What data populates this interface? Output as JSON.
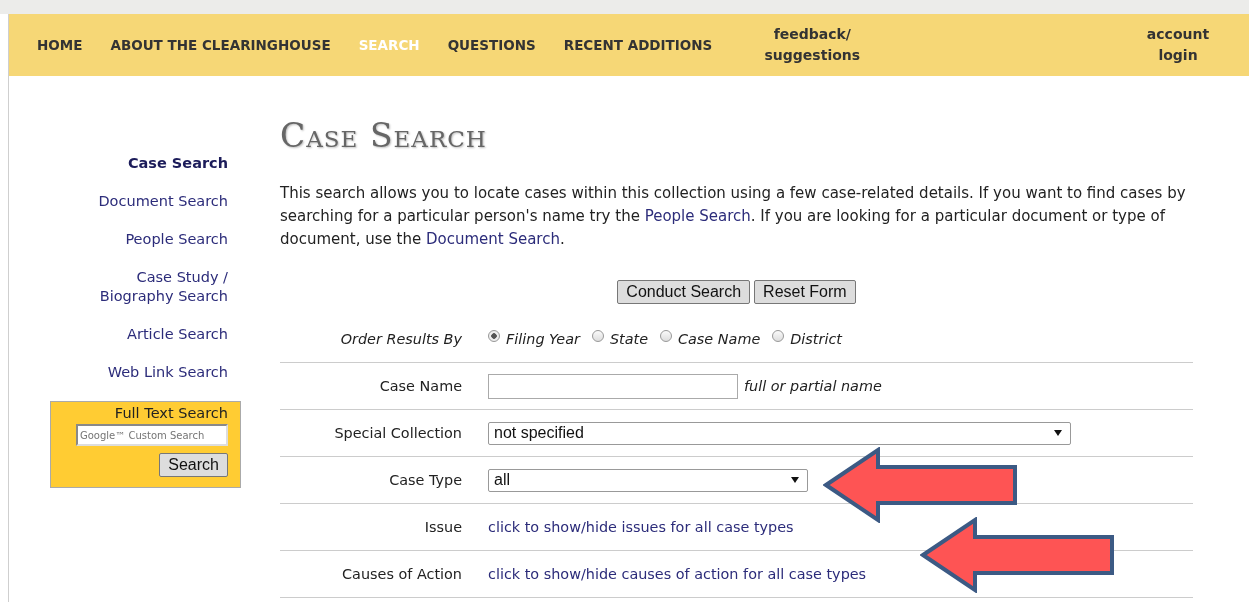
{
  "nav": [
    {
      "label": "HOME",
      "selected": false
    },
    {
      "label": "ABOUT THE CLEARINGHOUSE",
      "selected": false
    },
    {
      "label": "SEARCH",
      "selected": true
    },
    {
      "label": "QUESTIONS",
      "selected": false
    },
    {
      "label": "RECENT ADDITIONS",
      "selected": false
    },
    {
      "label": "feedback/ suggestions",
      "selected": false
    },
    {
      "label": "account login",
      "selected": false
    }
  ],
  "sidebar": {
    "items": [
      {
        "label": "Case Search",
        "selected": true
      },
      {
        "label": "Document Search",
        "selected": false
      },
      {
        "label": "People Search",
        "selected": false
      },
      {
        "label": "Case Study / Biography Search",
        "selected": false
      },
      {
        "label": "Article Search",
        "selected": false
      },
      {
        "label": "Web Link Search",
        "selected": false
      }
    ],
    "full_text_search": {
      "title": "Full Text Search",
      "placeholder": "Google™ Custom Search",
      "button": "Search"
    }
  },
  "main": {
    "title": "Case Search",
    "intro": {
      "parts": [
        {
          "kind": "text",
          "text": "This search allows you to locate cases within this collection using a few case-related details. If you want to find cases by searching for a particular person's name try the "
        },
        {
          "kind": "link",
          "text": "People Search"
        },
        {
          "kind": "text",
          "text": ". If you are looking for a particular document or type of document, use the "
        },
        {
          "kind": "link",
          "text": "Document Search"
        },
        {
          "kind": "text",
          "text": "."
        }
      ]
    },
    "buttons": [
      "Conduct Search",
      "Reset Form"
    ],
    "form": [
      {
        "kind": "radios",
        "label": "Order Results By",
        "options": [
          {
            "label": "Filing Year",
            "selected": true
          },
          {
            "label": "State",
            "selected": false
          },
          {
            "label": "Case Name",
            "selected": false
          },
          {
            "label": "District",
            "selected": false
          }
        ]
      },
      {
        "kind": "text",
        "label": "Case Name",
        "hint": "full or partial name"
      },
      {
        "kind": "select",
        "label": "Special Collection",
        "value": "not specified",
        "wide": true
      },
      {
        "kind": "select",
        "label": "Case Type",
        "value": "all",
        "wide": false
      },
      {
        "kind": "link",
        "label": "Issue",
        "link": "click to show/hide issues for all case types"
      },
      {
        "kind": "link",
        "label": "Causes of Action",
        "link": "click to show/hide causes of action for all case types"
      }
    ]
  },
  "callouts": [
    {
      "kind": "arrow"
    },
    {
      "kind": "arrow"
    }
  ]
}
